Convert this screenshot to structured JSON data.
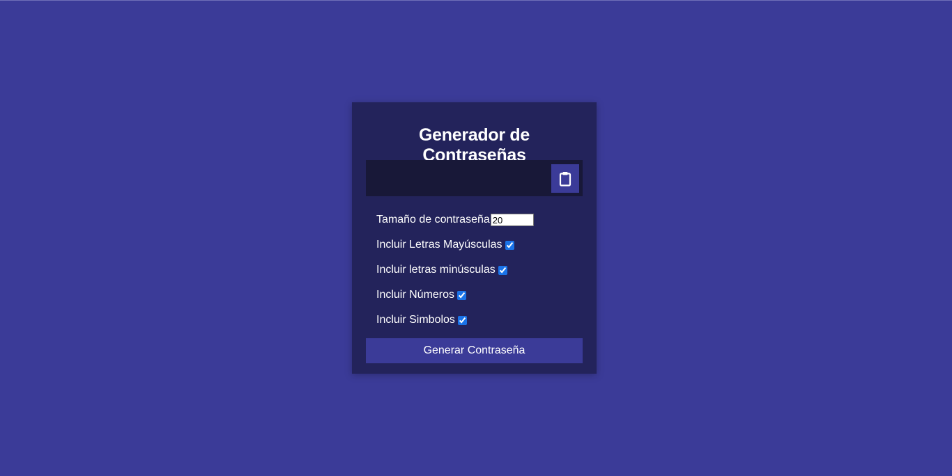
{
  "app": {
    "title": "Generador de Contraseñas"
  },
  "result": {
    "value": ""
  },
  "icons": {
    "copy": "clipboard-icon"
  },
  "settings": {
    "length_label": "Tamaño de contraseña",
    "length_value": "20",
    "uppercase_label": "Incluir Letras Mayúsculas",
    "uppercase_checked": true,
    "lowercase_label": "Incluir letras minúsculas",
    "lowercase_checked": true,
    "numbers_label": "Incluir Números",
    "numbers_checked": true,
    "symbols_label": "Incluir Simbolos",
    "symbols_checked": true
  },
  "actions": {
    "generate_label": "Generar Contraseña"
  },
  "colors": {
    "background": "#3b3b98",
    "card": "#23235b",
    "result_box": "#181838",
    "button": "#3b3b98"
  }
}
